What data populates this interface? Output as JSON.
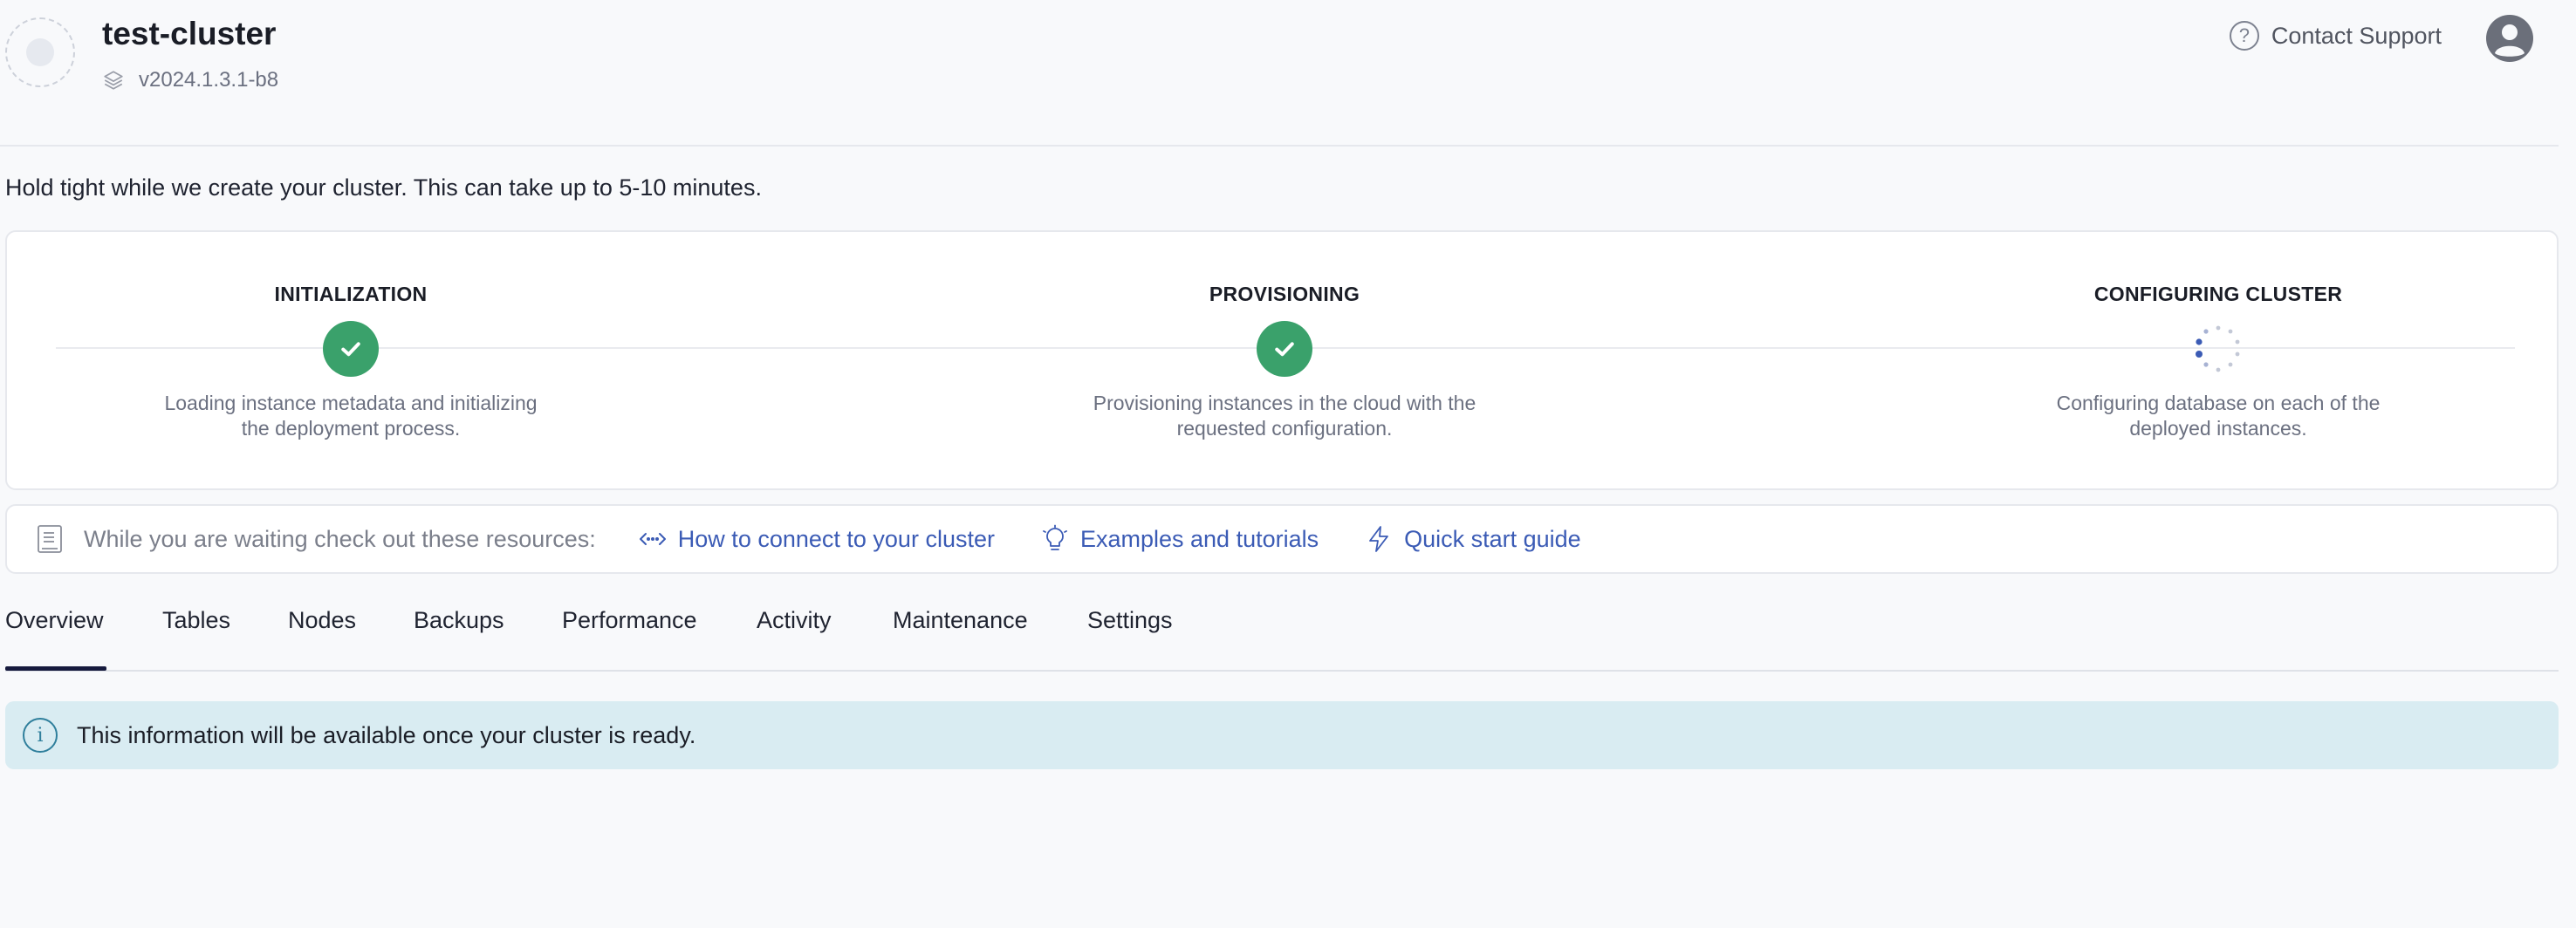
{
  "header": {
    "cluster_name": "test-cluster",
    "version": "v2024.1.3.1-b8",
    "support_label": "Contact Support"
  },
  "status_message": "Hold tight while we create your cluster. This can take up to 5-10 minutes.",
  "steps": [
    {
      "title": "INITIALIZATION",
      "desc_line1": "Loading instance metadata and initializing",
      "desc_line2": "the deployment process.",
      "state": "complete"
    },
    {
      "title": "PROVISIONING",
      "desc_line1": "Provisioning instances in the cloud with the",
      "desc_line2": "requested configuration.",
      "state": "complete"
    },
    {
      "title": "CONFIGURING CLUSTER",
      "desc_line1": "Configuring database on each of the",
      "desc_line2": "deployed instances.",
      "state": "in-progress"
    }
  ],
  "resources": {
    "label": "While you are waiting check out these resources:",
    "links": [
      {
        "label": "How to connect to your cluster",
        "icon": "code-connect-icon"
      },
      {
        "label": "Examples and tutorials",
        "icon": "lightbulb-icon"
      },
      {
        "label": "Quick start guide",
        "icon": "lightning-icon"
      }
    ]
  },
  "tabs": [
    "Overview",
    "Tables",
    "Nodes",
    "Backups",
    "Performance",
    "Activity",
    "Maintenance",
    "Settings"
  ],
  "active_tab": "Overview",
  "info_banner": "This information will be available once your cluster is ready.",
  "colors": {
    "success": "#3aa16b",
    "link": "#3b5bb5",
    "tab_active": "#161a3d",
    "info_bg": "#d9ecf2",
    "spinner": "#3b5bb5"
  }
}
